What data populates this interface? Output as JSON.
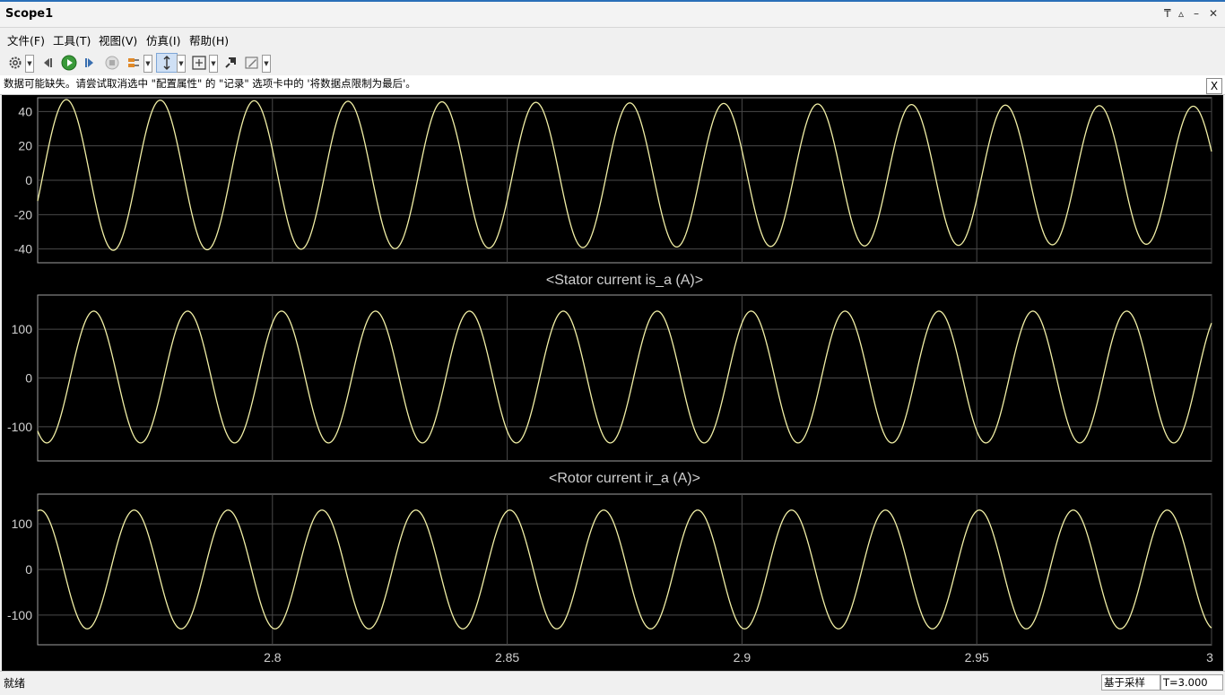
{
  "window": {
    "title": "Scope1",
    "controls": {
      "pin": "₸",
      "undock": "▵",
      "minimize": "–",
      "close": "✕"
    }
  },
  "menu": [
    "文件(F)",
    "工具(T)",
    "视图(V)",
    "仿真(I)",
    "帮助(H)"
  ],
  "toolbar": {
    "icons": [
      "settings-gear-icon",
      "step-back-icon",
      "run-icon",
      "step-forward-icon",
      "stop-icon",
      "signal-select-icon",
      "zoom-y-icon",
      "autoscale-icon",
      "highlight-simulink-block-icon",
      "style-pen-icon"
    ]
  },
  "warning": {
    "text": "数据可能缺失。请尝试取消选中 \"配置属性\" 的 \"记录\" 选项卡中的 '将数据点限制为最后'。",
    "close": "X"
  },
  "status": {
    "left": "就绪",
    "mode": "基于采样",
    "time": "T=3.000"
  },
  "colors": {
    "trace": "#f2f0a6",
    "plot_bg": "#000000",
    "grid": "#4a4a4a",
    "axis_text": "#d0d0d0",
    "accent": "#2a6fb8"
  },
  "chart_data": [
    {
      "type": "line",
      "title": "",
      "xlim": [
        2.75,
        3.0
      ],
      "ylim": [
        -48,
        48
      ],
      "yticks": [
        -40,
        -20,
        0,
        20,
        40
      ],
      "xticks": [
        2.8,
        2.85,
        2.9,
        2.95,
        3
      ],
      "grid": true,
      "series": [
        {
          "amplitude_start": 44,
          "amplitude_end": 40,
          "frequency_hz": 50,
          "offset": 3,
          "phase_deg": 160
        }
      ]
    },
    {
      "type": "line",
      "title": "<Stator current is_a (A)>",
      "xlim": [
        2.75,
        3.0
      ],
      "ylim": [
        -170,
        170
      ],
      "yticks": [
        -100,
        0,
        100
      ],
      "xticks": [
        2.8,
        2.85,
        2.9,
        2.95,
        3
      ],
      "grid": true,
      "series": [
        {
          "amplitude_start": 135,
          "amplitude_end": 135,
          "frequency_hz": 50,
          "offset": 2,
          "phase_deg": 55
        }
      ]
    },
    {
      "type": "line",
      "title": "<Rotor current ir_a (A)>",
      "xlim": [
        2.75,
        3.0
      ],
      "ylim": [
        -165,
        165
      ],
      "yticks": [
        -100,
        0,
        100
      ],
      "xticks": [
        2.8,
        2.85,
        2.9,
        2.95,
        3
      ],
      "xlabels": [
        "2.8",
        "2.85",
        "2.9",
        "2.95",
        "3"
      ],
      "grid": true,
      "series": [
        {
          "amplitude_start": 130,
          "amplitude_end": 130,
          "frequency_hz": 50,
          "offset": 0,
          "phase_deg": -100
        }
      ]
    }
  ]
}
